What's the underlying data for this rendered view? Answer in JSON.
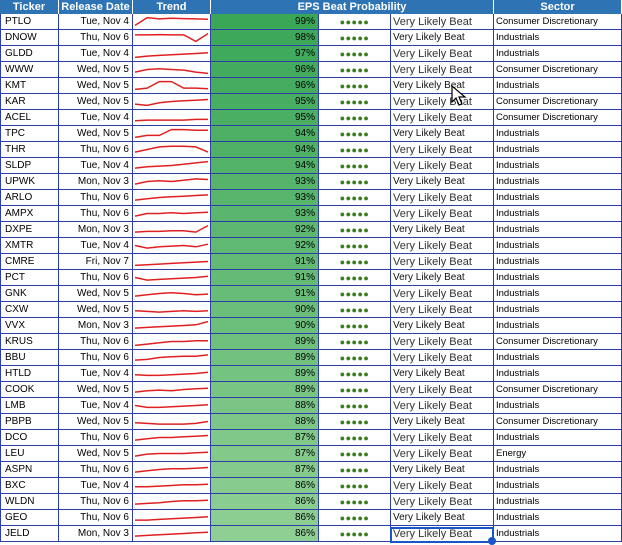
{
  "headers": {
    "ticker": "Ticker",
    "release_date": "Release Date",
    "trend": "Trend",
    "eps": "EPS Beat Probability",
    "sector": "Sector"
  },
  "colors": {
    "header_bg": "#2e74b5",
    "grid": "#2d3ea8",
    "trend_line": "#e02020",
    "bar_top": "#3aa757",
    "bar_bottom": "#8fcf94",
    "dots": "#3a7d1e",
    "selection": "#1a56c8"
  },
  "icons": {
    "rating": "five-dot-rating-icon",
    "cursor": "mouse-pointer-icon"
  },
  "rows": [
    {
      "ticker": "PTLO",
      "date": "Tue, Nov 4",
      "pct": "99%",
      "label": "Very Likely Beat",
      "sector": "Consumer Discretionary",
      "trend": [
        0.2,
        0.8,
        0.7,
        0.75,
        0.72,
        0.7,
        0.68
      ]
    },
    {
      "ticker": "DNOW",
      "date": "Thu, Nov 6",
      "pct": "98%",
      "label": "Very Likely Beat",
      "sector": "Industrials",
      "trend": [
        0.7,
        0.7,
        0.72,
        0.7,
        0.7,
        0.2,
        0.8
      ]
    },
    {
      "ticker": "GLDD",
      "date": "Tue, Nov 4",
      "pct": "97%",
      "label": "Very Likely Beat",
      "sector": "Industrials",
      "trend": [
        0.2,
        0.3,
        0.35,
        0.4,
        0.45,
        0.5,
        0.55
      ]
    },
    {
      "ticker": "WWW",
      "date": "Wed, Nov 5",
      "pct": "96%",
      "label": "Very Likely Beat",
      "sector": "Consumer Discretionary",
      "trend": [
        0.3,
        0.5,
        0.55,
        0.5,
        0.45,
        0.3,
        0.2
      ]
    },
    {
      "ticker": "KMT",
      "date": "Wed, Nov 5",
      "pct": "96%",
      "label": "Very Likely Beat",
      "sector": "Industrials",
      "trend": [
        0.2,
        0.3,
        0.8,
        0.8,
        0.3,
        0.3,
        0.25
      ]
    },
    {
      "ticker": "KAR",
      "date": "Wed, Nov 5",
      "pct": "95%",
      "label": "Very Likely Beat",
      "sector": "Consumer Discretionary",
      "trend": [
        0.3,
        0.2,
        0.4,
        0.5,
        0.55,
        0.6,
        0.65
      ]
    },
    {
      "ticker": "ACEL",
      "date": "Tue, Nov 4",
      "pct": "95%",
      "label": "Very Likely Beat",
      "sector": "Consumer Discretionary",
      "trend": [
        0.25,
        0.3,
        0.3,
        0.3,
        0.3,
        0.35,
        0.35
      ]
    },
    {
      "ticker": "TPC",
      "date": "Wed, Nov 5",
      "pct": "94%",
      "label": "Very Likely Beat",
      "sector": "Industrials",
      "trend": [
        0.2,
        0.35,
        0.35,
        0.8,
        0.8,
        0.75,
        0.75
      ]
    },
    {
      "ticker": "THR",
      "date": "Thu, Nov 6",
      "pct": "94%",
      "label": "Very Likely Beat",
      "sector": "Industrials",
      "trend": [
        0.3,
        0.5,
        0.7,
        0.75,
        0.75,
        0.7,
        0.3
      ]
    },
    {
      "ticker": "SLDP",
      "date": "Tue, Nov 4",
      "pct": "94%",
      "label": "Very Likely Beat",
      "sector": "Industrials",
      "trend": [
        0.3,
        0.4,
        0.45,
        0.5,
        0.6,
        0.7,
        0.8
      ]
    },
    {
      "ticker": "UPWK",
      "date": "Mon, Nov 3",
      "pct": "93%",
      "label": "Very Likely Beat",
      "sector": "Industrials",
      "trend": [
        0.3,
        0.5,
        0.55,
        0.5,
        0.6,
        0.7,
        0.65
      ]
    },
    {
      "ticker": "ARLO",
      "date": "Thu, Nov 6",
      "pct": "93%",
      "label": "Very Likely Beat",
      "sector": "Industrials",
      "trend": [
        0.3,
        0.4,
        0.5,
        0.55,
        0.6,
        0.65,
        0.7
      ]
    },
    {
      "ticker": "AMPX",
      "date": "Thu, Nov 6",
      "pct": "93%",
      "label": "Very Likely Beat",
      "sector": "Industrials",
      "trend": [
        0.3,
        0.5,
        0.5,
        0.55,
        0.5,
        0.55,
        0.6
      ]
    },
    {
      "ticker": "DXPE",
      "date": "Mon, Nov 3",
      "pct": "92%",
      "label": "Very Likely Beat",
      "sector": "Industrials",
      "trend": [
        0.3,
        0.35,
        0.35,
        0.4,
        0.4,
        0.3,
        0.8
      ]
    },
    {
      "ticker": "XMTR",
      "date": "Tue, Nov 4",
      "pct": "92%",
      "label": "Very Likely Beat",
      "sector": "Industrials",
      "trend": [
        0.5,
        0.3,
        0.4,
        0.45,
        0.5,
        0.4,
        0.6
      ]
    },
    {
      "ticker": "CMRE",
      "date": "Fri, Nov 7",
      "pct": "91%",
      "label": "Very Likely Beat",
      "sector": "Industrials",
      "trend": [
        0.2,
        0.25,
        0.3,
        0.35,
        0.4,
        0.45,
        0.5
      ]
    },
    {
      "ticker": "PCT",
      "date": "Thu, Nov 6",
      "pct": "91%",
      "label": "Very Likely Beat",
      "sector": "Industrials",
      "trend": [
        0.5,
        0.3,
        0.35,
        0.4,
        0.45,
        0.5,
        0.6
      ]
    },
    {
      "ticker": "GNK",
      "date": "Wed, Nov 5",
      "pct": "91%",
      "label": "Very Likely Beat",
      "sector": "Industrials",
      "trend": [
        0.3,
        0.4,
        0.5,
        0.55,
        0.5,
        0.4,
        0.45
      ]
    },
    {
      "ticker": "CXW",
      "date": "Wed, Nov 5",
      "pct": "90%",
      "label": "Very Likely Beat",
      "sector": "Industrials",
      "trend": [
        0.4,
        0.35,
        0.3,
        0.35,
        0.4,
        0.35,
        0.4
      ]
    },
    {
      "ticker": "VVX",
      "date": "Mon, Nov 3",
      "pct": "90%",
      "label": "Very Likely Beat",
      "sector": "Industrials",
      "trend": [
        0.3,
        0.35,
        0.4,
        0.45,
        0.5,
        0.55,
        0.8
      ]
    },
    {
      "ticker": "KRUS",
      "date": "Thu, Nov 6",
      "pct": "89%",
      "label": "Very Likely Beat",
      "sector": "Consumer Discretionary",
      "trend": [
        0.2,
        0.3,
        0.4,
        0.5,
        0.5,
        0.55,
        0.55
      ]
    },
    {
      "ticker": "BBU",
      "date": "Thu, Nov 6",
      "pct": "89%",
      "label": "Very Likely Beat",
      "sector": "Industrials",
      "trend": [
        0.3,
        0.35,
        0.5,
        0.55,
        0.6,
        0.6,
        0.7
      ]
    },
    {
      "ticker": "HTLD",
      "date": "Tue, Nov 4",
      "pct": "89%",
      "label": "Very Likely Beat",
      "sector": "Industrials",
      "trend": [
        0.4,
        0.35,
        0.35,
        0.4,
        0.45,
        0.5,
        0.6
      ]
    },
    {
      "ticker": "COOK",
      "date": "Wed, Nov 5",
      "pct": "89%",
      "label": "Very Likely Beat",
      "sector": "Consumer Discretionary",
      "trend": [
        0.3,
        0.4,
        0.45,
        0.4,
        0.5,
        0.55,
        0.6
      ]
    },
    {
      "ticker": "LMB",
      "date": "Tue, Nov 4",
      "pct": "88%",
      "label": "Very Likely Beat",
      "sector": "Industrials",
      "trend": [
        0.5,
        0.35,
        0.35,
        0.4,
        0.45,
        0.5,
        0.55
      ]
    },
    {
      "ticker": "PBPB",
      "date": "Wed, Nov 5",
      "pct": "88%",
      "label": "Very Likely Beat",
      "sector": "Consumer Discretionary",
      "trend": [
        0.4,
        0.35,
        0.3,
        0.3,
        0.3,
        0.35,
        0.5
      ]
    },
    {
      "ticker": "DCO",
      "date": "Thu, Nov 6",
      "pct": "87%",
      "label": "Very Likely Beat",
      "sector": "Industrials",
      "trend": [
        0.3,
        0.4,
        0.5,
        0.5,
        0.55,
        0.6,
        0.65
      ]
    },
    {
      "ticker": "LEU",
      "date": "Wed, Nov 5",
      "pct": "87%",
      "label": "Very Likely Beat",
      "sector": "Energy",
      "trend": [
        0.3,
        0.45,
        0.5,
        0.5,
        0.5,
        0.55,
        0.6
      ]
    },
    {
      "ticker": "ASPN",
      "date": "Thu, Nov 6",
      "pct": "87%",
      "label": "Very Likely Beat",
      "sector": "Industrials",
      "trend": [
        0.3,
        0.4,
        0.5,
        0.55,
        0.55,
        0.6,
        0.65
      ]
    },
    {
      "ticker": "BXC",
      "date": "Tue, Nov 4",
      "pct": "86%",
      "label": "Very Likely Beat",
      "sector": "Industrials",
      "trend": [
        0.4,
        0.4,
        0.45,
        0.5,
        0.55,
        0.55,
        0.6
      ]
    },
    {
      "ticker": "WLDN",
      "date": "Thu, Nov 6",
      "pct": "86%",
      "label": "Very Likely Beat",
      "sector": "Industrials",
      "trend": [
        0.3,
        0.35,
        0.4,
        0.5,
        0.55,
        0.55,
        0.6
      ]
    },
    {
      "ticker": "GEO",
      "date": "Thu, Nov 6",
      "pct": "86%",
      "label": "Very Likely Beat",
      "sector": "Industrials",
      "trend": [
        0.3,
        0.3,
        0.35,
        0.4,
        0.45,
        0.5,
        0.55
      ]
    },
    {
      "ticker": "JELD",
      "date": "Mon, Nov 3",
      "pct": "86%",
      "label": "Very Likely Beat",
      "sector": "Industrials",
      "trend": [
        0.3,
        0.35,
        0.4,
        0.45,
        0.5,
        0.55,
        0.6
      ]
    }
  ]
}
